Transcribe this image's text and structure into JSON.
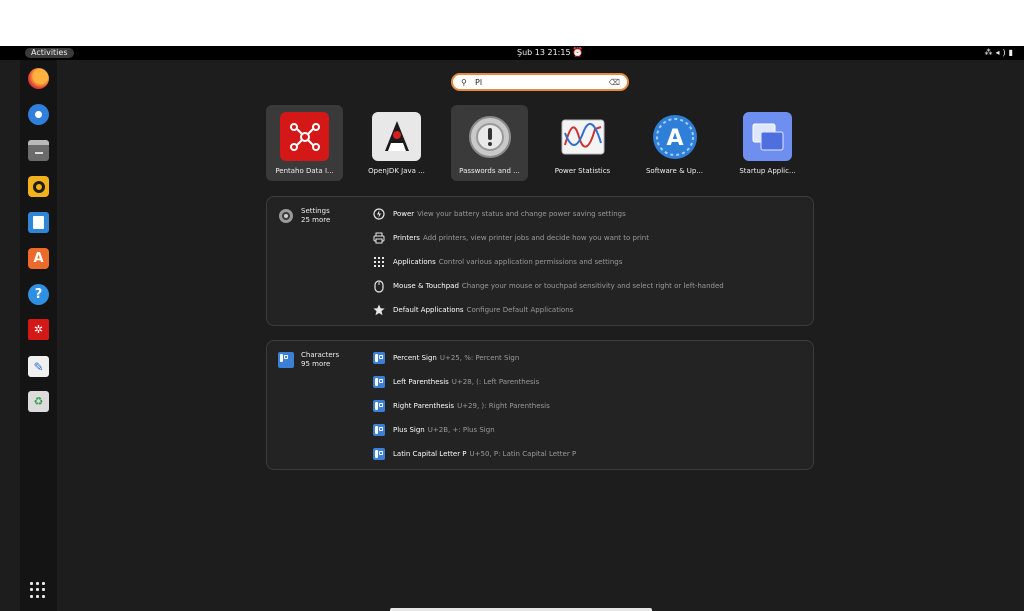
{
  "topbar": {
    "activities_label": "Activities",
    "clock": "Şub 13  21:15",
    "clock_icon": "alarm-icon",
    "tray": [
      "network-icon",
      "volume-icon",
      "battery-icon"
    ]
  },
  "dock": {
    "items": [
      {
        "name": "firefox",
        "icon": "firefox-icon"
      },
      {
        "name": "thunderbird",
        "icon": "thunderbird-icon"
      },
      {
        "name": "files",
        "icon": "files-icon"
      },
      {
        "name": "rhythmbox",
        "icon": "rhythmbox-icon"
      },
      {
        "name": "writer",
        "icon": "writer-icon"
      },
      {
        "name": "app-center",
        "icon": "app-center-icon"
      },
      {
        "name": "help",
        "icon": "help-icon"
      },
      {
        "name": "pentaho",
        "icon": "pentaho-icon"
      },
      {
        "name": "text-editor",
        "icon": "text-editor-icon"
      },
      {
        "name": "trash",
        "icon": "trash-icon"
      }
    ],
    "show_apps_icon": "grid-icon"
  },
  "search": {
    "query": "Pl",
    "icon": "search-icon",
    "clear_icon": "clear-icon"
  },
  "apps": [
    {
      "label": "Pentaho Data I...",
      "icon": "pentaho-icon"
    },
    {
      "label": "OpenJDK Java ...",
      "icon": "java-duke-icon"
    },
    {
      "label": "Passwords and ...",
      "icon": "passwords-keyring-icon"
    },
    {
      "label": "Power Statistics",
      "icon": "power-statistics-icon"
    },
    {
      "label": "Software & Up...",
      "icon": "software-updates-icon"
    },
    {
      "label": "Startup Applic...",
      "icon": "startup-applications-icon"
    }
  ],
  "settings": {
    "name": "Settings",
    "more": "25 more",
    "icon": "settings-gear-icon",
    "results": [
      {
        "title": "Power",
        "desc": "View your battery status and change power saving settings",
        "icon": "power-icon"
      },
      {
        "title": "Printers",
        "desc": "Add printers, view printer jobs and decide how you want to print",
        "icon": "printer-icon"
      },
      {
        "title": "Applications",
        "desc": "Control various application permissions and settings",
        "icon": "apps-grid-icon"
      },
      {
        "title": "Mouse & Touchpad",
        "desc": "Change your mouse or touchpad sensitivity and select right or left-handed",
        "icon": "mouse-icon"
      },
      {
        "title": "Default Applications",
        "desc": "Configure Default Applications",
        "icon": "star-icon"
      }
    ]
  },
  "characters": {
    "name": "Characters",
    "more": "95 more",
    "icon": "characters-icon",
    "results": [
      {
        "title": "Percent Sign",
        "desc": "U+25, %: Percent Sign",
        "icon": "characters-icon"
      },
      {
        "title": "Left Parenthesis",
        "desc": "U+28, (: Left Parenthesis",
        "icon": "characters-icon"
      },
      {
        "title": "Right Parenthesis",
        "desc": "U+29, ): Right Parenthesis",
        "icon": "characters-icon"
      },
      {
        "title": "Plus Sign",
        "desc": "U+2B, +: Plus Sign",
        "icon": "characters-icon"
      },
      {
        "title": "Latin Capital Letter P",
        "desc": "U+50, P: Latin Capital Letter P",
        "icon": "characters-icon"
      }
    ]
  },
  "colors": {
    "accent": "#e58a3f",
    "background": "#1d1d1d",
    "panel": "#232323"
  }
}
